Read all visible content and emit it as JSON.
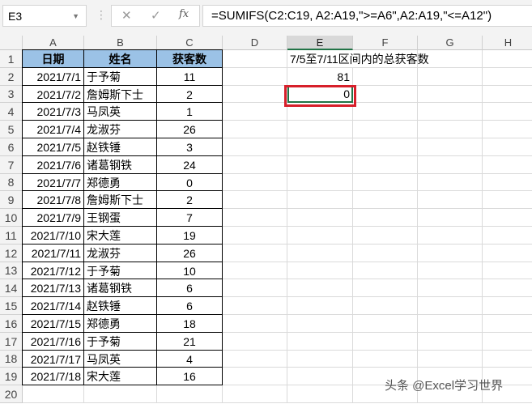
{
  "name_box": "E3",
  "formula": "=SUMIFS(C2:C19, A2:A19,\">=A6\",A2:A19,\"<=A12\")",
  "icons": {
    "cancel": "✕",
    "enter": "✓",
    "fx": "fx"
  },
  "columns": [
    "A",
    "B",
    "C",
    "D",
    "E",
    "F",
    "G",
    "H"
  ],
  "headers": [
    "日期",
    "姓名",
    "获客数"
  ],
  "rows": [
    [
      "2021/7/1",
      "于予菊",
      "11"
    ],
    [
      "2021/7/2",
      "詹姆斯下士",
      "2"
    ],
    [
      "2021/7/3",
      "马凤英",
      "1"
    ],
    [
      "2021/7/4",
      "龙淑芬",
      "26"
    ],
    [
      "2021/7/5",
      "赵铁锤",
      "3"
    ],
    [
      "2021/7/6",
      "诸葛钢铁",
      "24"
    ],
    [
      "2021/7/7",
      "郑德勇",
      "0"
    ],
    [
      "2021/7/8",
      "詹姆斯下士",
      "2"
    ],
    [
      "2021/7/9",
      "王钢蛋",
      "7"
    ],
    [
      "2021/7/10",
      "宋大莲",
      "19"
    ],
    [
      "2021/7/11",
      "龙淑芬",
      "26"
    ],
    [
      "2021/7/12",
      "于予菊",
      "10"
    ],
    [
      "2021/7/13",
      "诸葛钢铁",
      "6"
    ],
    [
      "2021/7/14",
      "赵铁锤",
      "6"
    ],
    [
      "2021/7/15",
      "郑德勇",
      "18"
    ],
    [
      "2021/7/16",
      "于予菊",
      "21"
    ],
    [
      "2021/7/17",
      "马凤英",
      "4"
    ],
    [
      "2021/7/18",
      "宋大莲",
      "16"
    ]
  ],
  "e1": "7/5至7/11区间内的总获客数",
  "e2": "81",
  "e3": "0",
  "watermark": "头条 @Excel学习世界"
}
